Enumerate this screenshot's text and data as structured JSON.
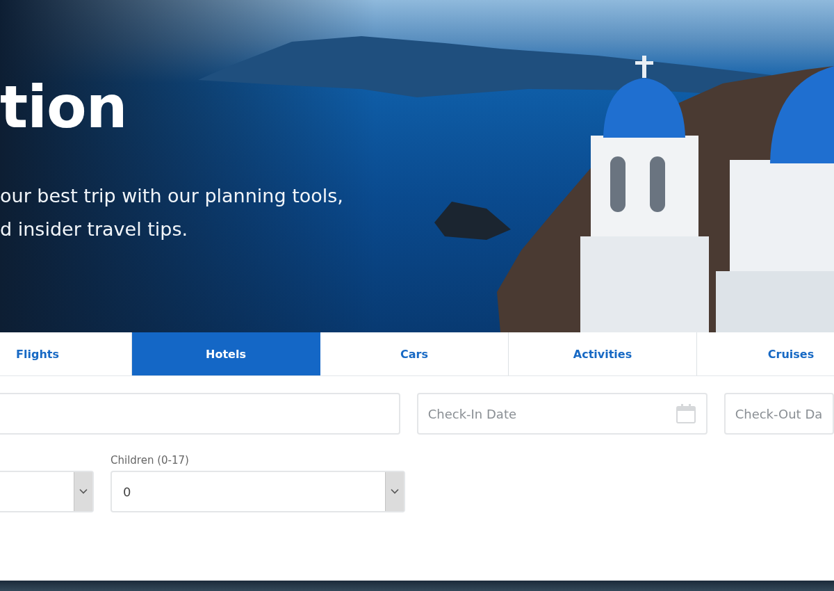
{
  "hero": {
    "heading": "tion",
    "tagline": "our best trip with our planning tools,\nd insider travel tips."
  },
  "tabs": [
    {
      "label": "Flights",
      "selected": false
    },
    {
      "label": "Hotels",
      "selected": true
    },
    {
      "label": "Cars",
      "selected": false
    },
    {
      "label": "Activities",
      "selected": false
    },
    {
      "label": "Cruises",
      "selected": false
    }
  ],
  "check_in": {
    "placeholder": "Check-In Date"
  },
  "check_out": {
    "placeholder": "Check-Out Da"
  },
  "children_select": {
    "label": "Children (0-17)",
    "value": "0"
  }
}
